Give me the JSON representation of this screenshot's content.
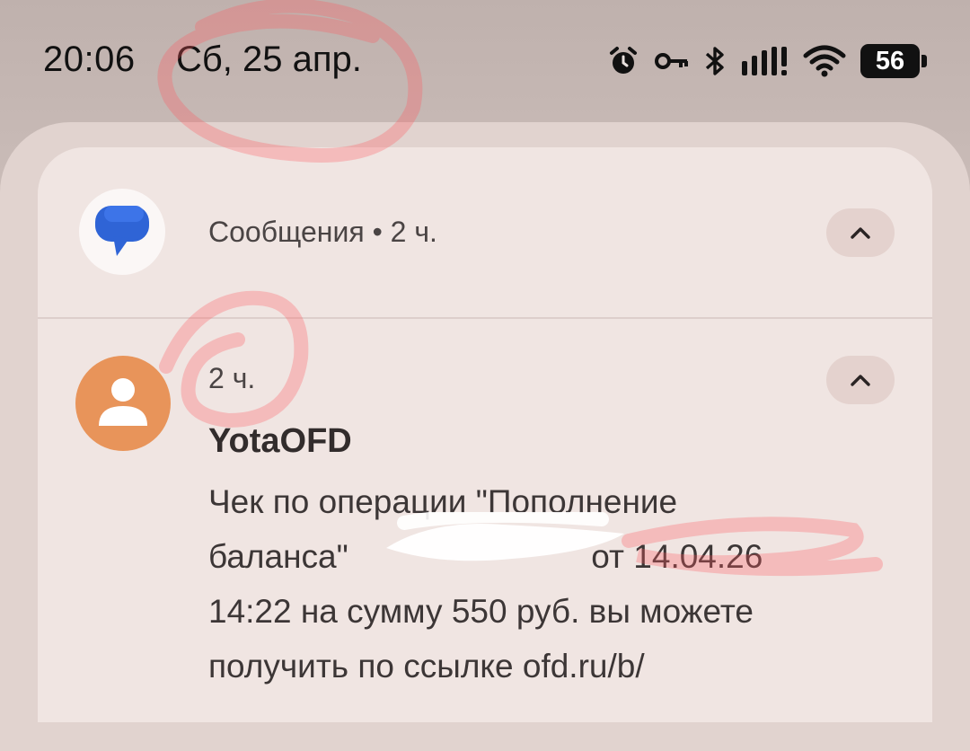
{
  "status_bar": {
    "time": "20:06",
    "date": "Сб, 25 апр.",
    "battery_level": "56",
    "icons": [
      "alarm-icon",
      "vpn-key-icon",
      "bluetooth-icon",
      "signal-icon",
      "wifi-icon",
      "battery-icon"
    ]
  },
  "notification": {
    "app_name": "Сообщения",
    "app_time": "2 ч.",
    "app_header": "Сообщения • 2 ч.",
    "message": {
      "time": "2 ч.",
      "sender": "YotaOFD",
      "body_line1": "Чек по операции \"Пополнение",
      "body_line2_start": "баланса\"",
      "body_line2_end": "от 14.04.26",
      "body_line3": "14:22 на сумму 550 руб. вы можете",
      "body_line4": "получить по ссылке ofd.ru/b/"
    }
  },
  "colors": {
    "app_icon_blue": "#2f64d6",
    "avatar_orange": "#e8945a",
    "annotation_red": "#ff5a5f"
  }
}
